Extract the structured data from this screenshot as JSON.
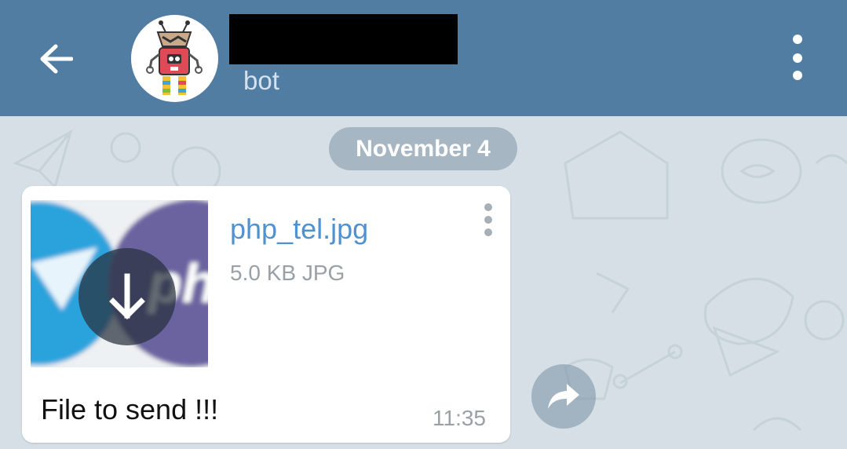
{
  "header": {
    "back_icon": "arrow-left-icon",
    "title": "",
    "subtitle": "bot",
    "menu_icon": "more-vertical-icon",
    "bg_color": "#527da3"
  },
  "chat": {
    "date_label": "November 4",
    "message": {
      "file_name": "php_tel.jpg",
      "file_meta": "5.0 KB JPG",
      "download_icon": "download-arrow-icon",
      "menu_icon": "more-vertical-icon",
      "caption": "File to send !!!",
      "time": "11:35"
    },
    "share_icon": "share-forward-icon"
  },
  "colors": {
    "link": "#4f92cf",
    "chat_bg": "#d5dfe5"
  }
}
